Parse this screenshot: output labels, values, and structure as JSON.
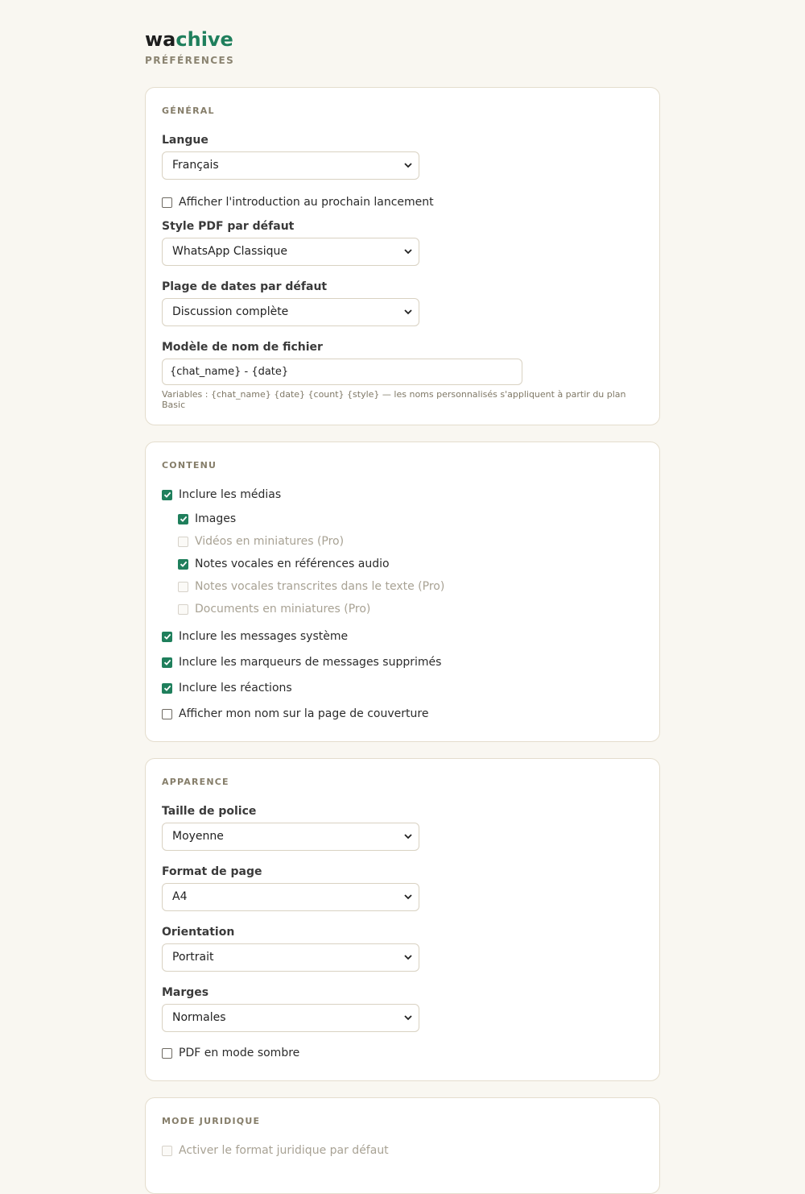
{
  "brand": {
    "part1": "wa",
    "part2": "chive"
  },
  "page_subtitle": "PRÉFÉRENCES",
  "colors": {
    "accent": "#1f7f5c",
    "background": "#f9f7f1",
    "card_border": "#e4ddcd"
  },
  "general": {
    "title": "GÉNÉRAL",
    "language_label": "Langue",
    "language_value": "Français",
    "show_intro_label": "Afficher l'introduction au prochain lancement",
    "show_intro_checked": false,
    "pdf_style_label": "Style PDF par défaut",
    "pdf_style_value": "WhatsApp Classique",
    "date_range_label": "Plage de dates par défaut",
    "date_range_value": "Discussion complète",
    "filename_label": "Modèle de nom de fichier",
    "filename_value": "{chat_name} - {date}",
    "filename_hint": "Variables : {chat_name} {date} {count} {style} — les noms personnalisés s'appliquent à partir du plan Basic"
  },
  "content": {
    "title": "CONTENU",
    "include_media": "Inclure les médias",
    "media_options": [
      {
        "label": "Images",
        "checked": true,
        "disabled": false
      },
      {
        "label": "Vidéos en miniatures (Pro)",
        "checked": false,
        "disabled": true
      },
      {
        "label": "Notes vocales en références audio",
        "checked": true,
        "disabled": false
      },
      {
        "label": "Notes vocales transcrites dans le texte (Pro)",
        "checked": false,
        "disabled": true
      },
      {
        "label": "Documents en miniatures (Pro)",
        "checked": false,
        "disabled": true
      }
    ],
    "include_system": "Inclure les messages système",
    "include_deleted": "Inclure les marqueurs de messages supprimés",
    "include_reactions": "Inclure les réactions",
    "show_name_cover": "Afficher mon nom sur la page de couverture"
  },
  "appearance": {
    "title": "APPARENCE",
    "font_size_label": "Taille de police",
    "font_size_value": "Moyenne",
    "page_format_label": "Format de page",
    "page_format_value": "A4",
    "orientation_label": "Orientation",
    "orientation_value": "Portrait",
    "margins_label": "Marges",
    "margins_value": "Normales",
    "dark_mode_label": "PDF en mode sombre"
  },
  "legal": {
    "title": "MODE JURIDIQUE",
    "enable_legal_label": "Activer le format juridique par défaut"
  },
  "icons": {
    "select_arrow": "chevron-down-icon",
    "check": "check-icon"
  }
}
